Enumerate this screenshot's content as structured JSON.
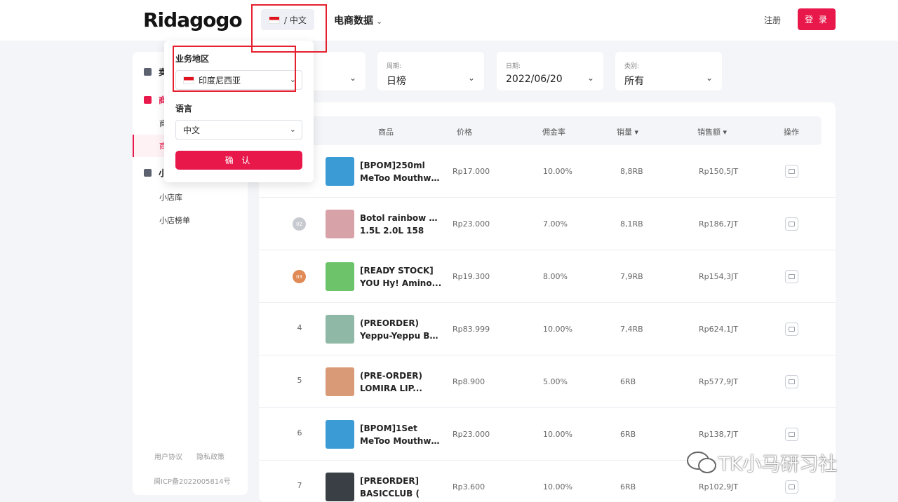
{
  "header": {
    "logo": "Ridagogo",
    "lang_pill": "/ 中文",
    "nav_ecommerce": "电商数据",
    "register": "注册",
    "login": "登 录"
  },
  "sidebar": {
    "items": [
      {
        "label": "卖",
        "icon": "calendar-icon"
      },
      {
        "label": "商",
        "icon": "shop-icon"
      },
      {
        "label": "小",
        "icon": "store-icon"
      }
    ],
    "sub_items_partial": [
      "商",
      "商"
    ],
    "store_subs": [
      "小店库",
      "小店榜单"
    ],
    "footer": {
      "agreement": "用户协议",
      "privacy": "隐私政策",
      "icp": "闽ICP备2022005814号"
    }
  },
  "filters": [
    {
      "label": "",
      "value": ""
    },
    {
      "label": "周期:",
      "value": "日榜"
    },
    {
      "label": "日期:",
      "value": "2022/06/20"
    },
    {
      "label": "类别:",
      "value": "所有"
    }
  ],
  "table": {
    "headers": {
      "product": "商品",
      "price": "价格",
      "commission": "佣金率",
      "sales": "销量 ▾",
      "revenue": "销售额 ▾",
      "action": "操作"
    },
    "rows": [
      {
        "rank": "",
        "medal": "gold",
        "name1": "[BPOM]250ml",
        "name2": "MeToo Mouthwa...",
        "price": "Rp17.000",
        "commission": "10.00%",
        "sales": "8,8RB",
        "revenue": "Rp150,5JT",
        "thumb_color": "#3a9bd5"
      },
      {
        "rank": "02",
        "medal": "silver",
        "name1": "Botol rainbow viral",
        "name2": "1.5L 2.0L 158",
        "price": "Rp23.000",
        "commission": "7.00%",
        "sales": "8,1RB",
        "revenue": "Rp186,7JT",
        "thumb_color": "#d8a3a8"
      },
      {
        "rank": "03",
        "medal": "bronze",
        "name1": "[READY STOCK]",
        "name2": "YOU Hy! Amino...",
        "price": "Rp19.300",
        "commission": "8.00%",
        "sales": "7,9RB",
        "revenue": "Rp154,3JT",
        "thumb_color": "#6cc36a"
      },
      {
        "rank": "4",
        "medal": "",
        "name1": "(PREORDER)",
        "name2": "Yeppu-Yeppu By...",
        "price": "Rp83.999",
        "commission": "10.00%",
        "sales": "7,4RB",
        "revenue": "Rp624,1JT",
        "thumb_color": "#8fb8a6"
      },
      {
        "rank": "5",
        "medal": "",
        "name1": "(PRE-ORDER)",
        "name2": "LOMIRA LIP...",
        "price": "Rp8.900",
        "commission": "5.00%",
        "sales": "6RB",
        "revenue": "Rp577,9JT",
        "thumb_color": "#d99a78"
      },
      {
        "rank": "6",
        "medal": "",
        "name1": "[BPOM]1Set",
        "name2": "MeToo Mouthwa...",
        "price": "Rp23.000",
        "commission": "10.00%",
        "sales": "6RB",
        "revenue": "Rp138,7JT",
        "thumb_color": "#3a9bd5"
      },
      {
        "rank": "7",
        "medal": "",
        "name1": "[PREORDER]",
        "name2": "BASICCLUB (",
        "price": "Rp3.600",
        "commission": "10.00%",
        "sales": "6RB",
        "revenue": "Rp102,9JT",
        "thumb_color": "#3a3f45"
      }
    ]
  },
  "dropdown": {
    "region_label": "业务地区",
    "region_value": "印度尼西亚",
    "language_label": "语言",
    "language_value": "中文",
    "confirm": "确 认"
  },
  "watermark": "TK小马研习社",
  "colors": {
    "accent": "#e8184b",
    "highlight_box": "#e5202e"
  }
}
